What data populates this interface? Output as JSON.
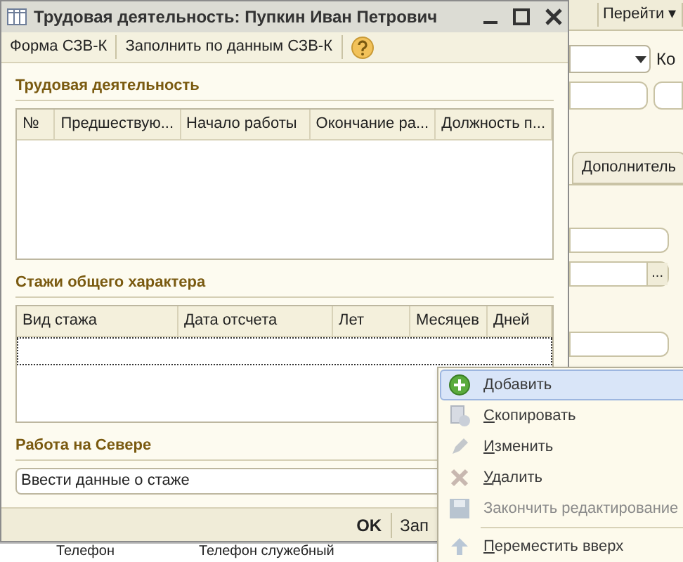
{
  "background": {
    "goto_button": "Перейти ▾",
    "code_label": "Ко",
    "tab": "Дополнитель",
    "field_button": "...",
    "bottom_cells": [
      "Телефон",
      "Телефон служебный"
    ]
  },
  "window": {
    "title": "Трудовая деятельность: Пупкин Иван Петрович"
  },
  "toolbar": {
    "buttons": [
      "Форма СЗВ-К",
      "Заполнить по данным СЗВ-К"
    ]
  },
  "sections": [
    {
      "title": "Трудовая деятельность",
      "kind": "table",
      "columns": [
        "№",
        "Предшествую...",
        "Начало работы",
        "Окончание ра...",
        "Должность п..."
      ]
    },
    {
      "title": "Стажи общего характера",
      "kind": "table",
      "columns": [
        "Вид стажа",
        "Дата отсчета",
        "Лет",
        "Месяцев",
        "Дней"
      ]
    },
    {
      "title": "Работа на Севере",
      "kind": "field",
      "value": "Ввести данные о стаже"
    }
  ],
  "footer": {
    "buttons": [
      "OK",
      "Зап"
    ]
  },
  "context_menu": {
    "items": [
      {
        "label": "Добавить",
        "kind": "add",
        "selected": true,
        "disabled": false
      },
      {
        "label": "Скопировать",
        "kind": "copy",
        "selected": false,
        "disabled": false
      },
      {
        "label": "Изменить",
        "kind": "edit",
        "selected": false,
        "disabled": false
      },
      {
        "label": "Удалить",
        "kind": "delete",
        "selected": false,
        "disabled": false
      },
      {
        "label": "Закончить редактирование",
        "kind": "save",
        "selected": false,
        "disabled": true
      },
      {
        "label": "Переместить вверх",
        "kind": "up",
        "selected": false,
        "disabled": false,
        "divider_before": true
      }
    ]
  }
}
